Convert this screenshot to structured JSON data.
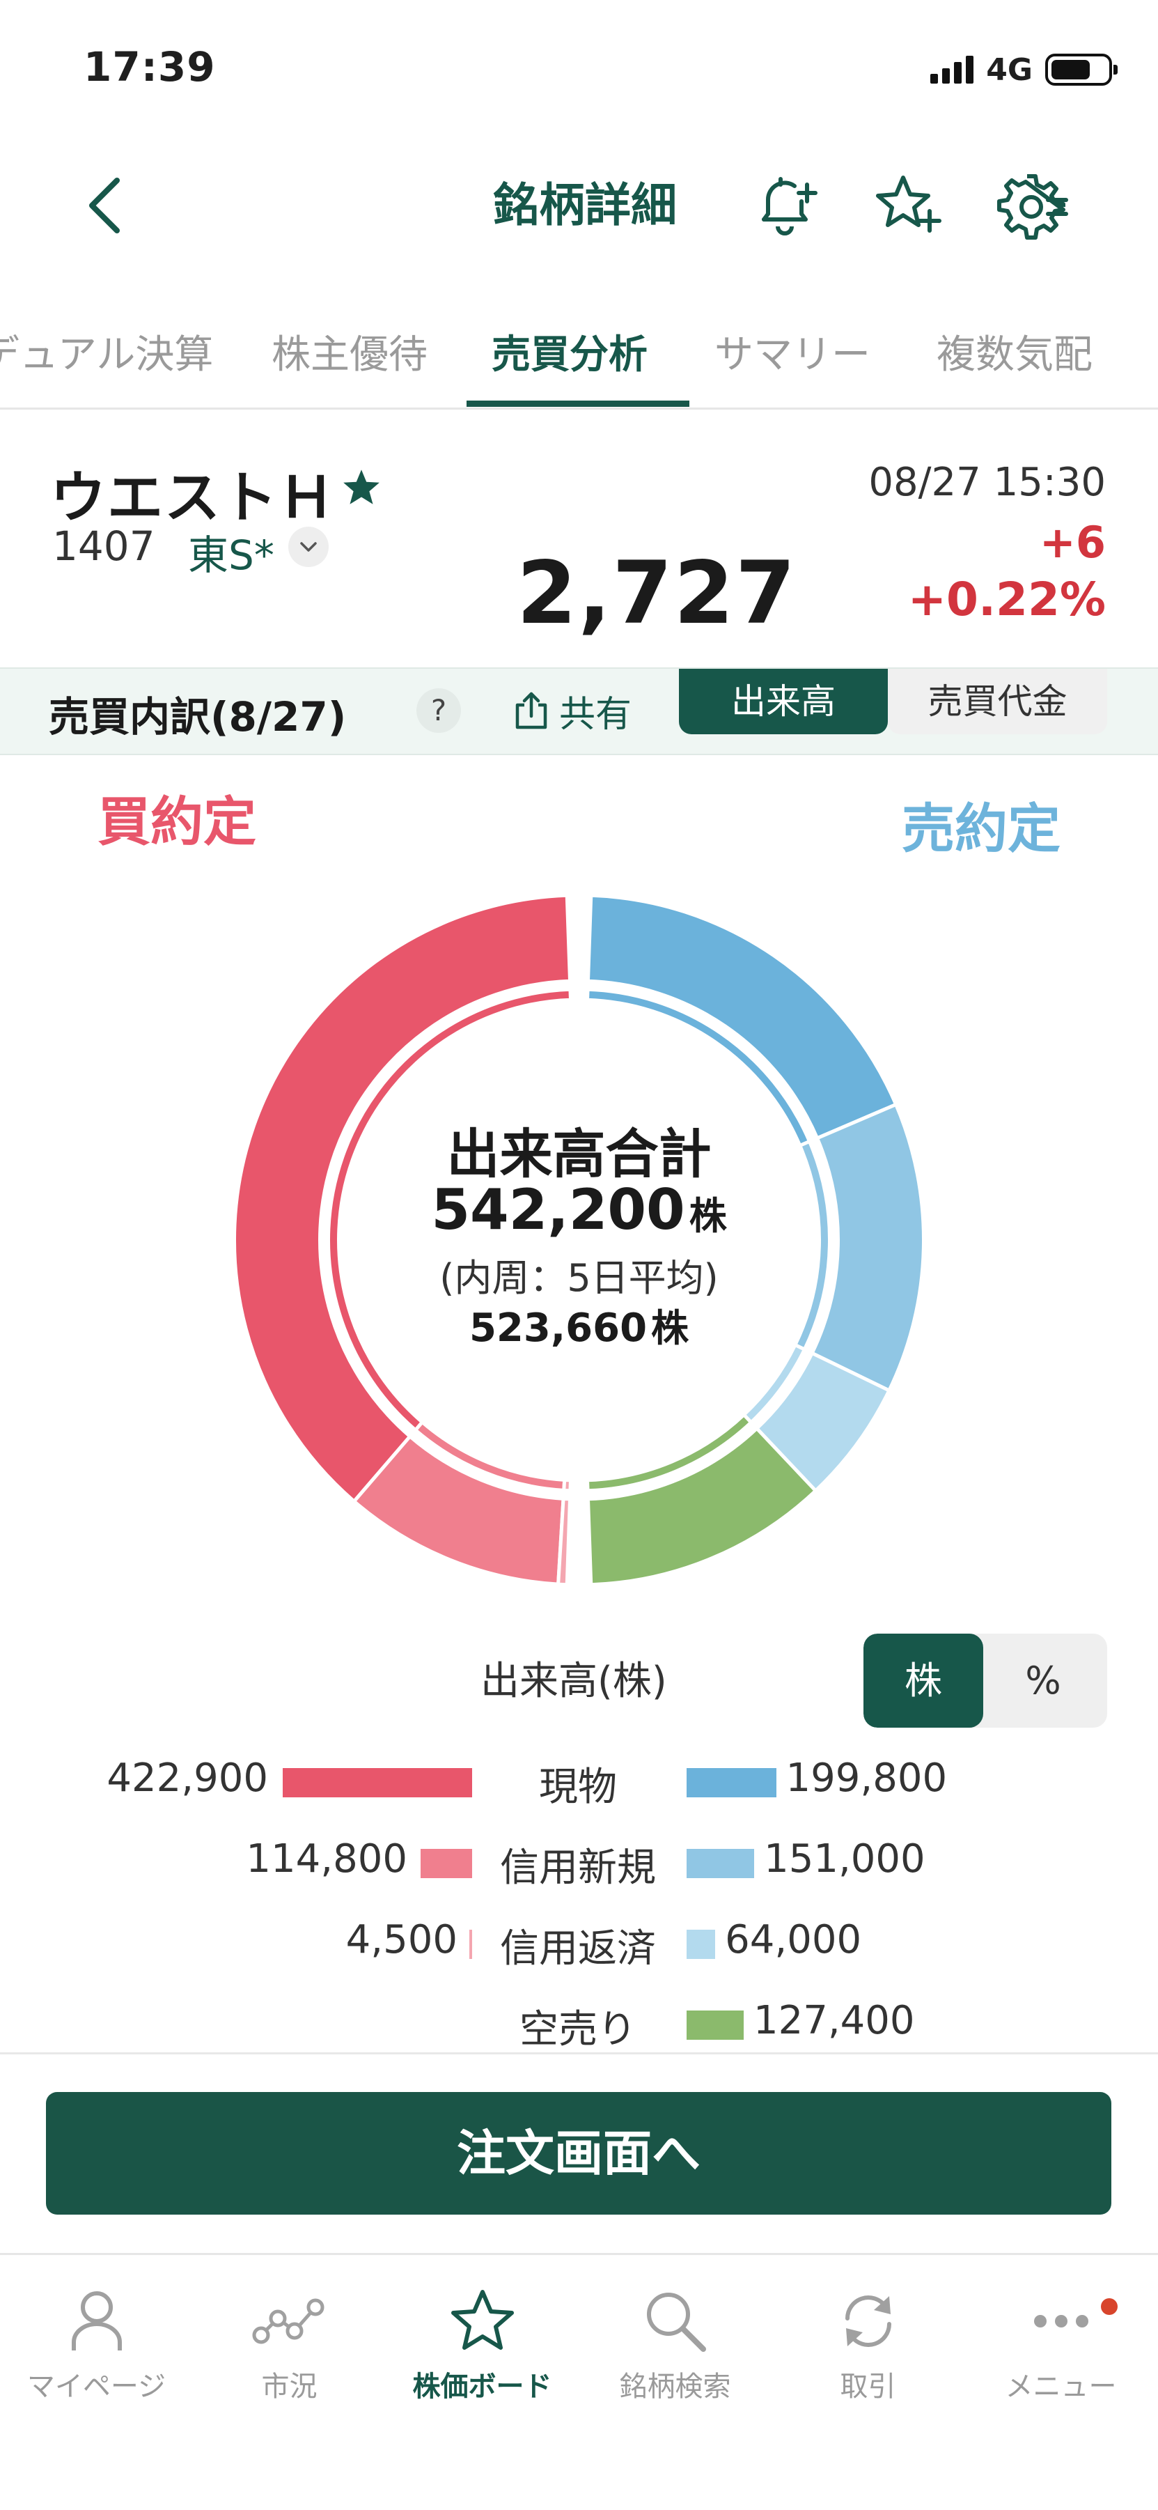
{
  "status_bar": {
    "time": "17:39",
    "network": "4G"
  },
  "header": {
    "title": "銘柄詳細"
  },
  "tabs": [
    {
      "label": "デュアル決算",
      "active": false
    },
    {
      "label": "株主優待",
      "active": false
    },
    {
      "label": "売買分析",
      "active": true
    },
    {
      "label": "サマリー",
      "active": false
    },
    {
      "label": "複数気配",
      "active": false
    }
  ],
  "stock": {
    "name": "ウエストＨ",
    "code": "1407",
    "market": "東S*",
    "price": "2,727",
    "datetime": "08/27 15:30",
    "change": "+6",
    "change_pct": "+0.22%"
  },
  "breakdown": {
    "title": "売買内訳(8/27)",
    "help": "?",
    "share_label": "共有",
    "mode_volume": "出来高",
    "mode_value": "売買代金"
  },
  "chart_labels": {
    "buy": "買約定",
    "sell": "売約定"
  },
  "center": {
    "title": "出来高合計",
    "total": "542,200",
    "unit": "株",
    "sub": "(内周：5日平均)",
    "avg": "523,660"
  },
  "legend": {
    "title": "出来高(株)",
    "unit_shares": "株",
    "unit_percent": "%"
  },
  "chart_data": {
    "type": "pie",
    "total": 542200,
    "outer_buy": [
      {
        "name": "現物",
        "value": 422900,
        "color": "#e8566b"
      },
      {
        "name": "信用新規",
        "value": 114800,
        "color": "#f07f8e"
      },
      {
        "name": "信用返済",
        "value": 4500,
        "color": "#f4a6b0"
      }
    ],
    "outer_sell": [
      {
        "name": "現物",
        "value": 199800,
        "color": "#6bb2db"
      },
      {
        "name": "信用新規",
        "value": 151000,
        "color": "#90c6e4"
      },
      {
        "name": "信用返済",
        "value": 64000,
        "color": "#b3daee"
      },
      {
        "name": "空売り",
        "value": 127400,
        "color": "#8bba6c"
      }
    ],
    "rows": [
      {
        "category": "現物",
        "buy": "422,900",
        "sell": "199,800"
      },
      {
        "category": "信用新規",
        "buy": "114,800",
        "sell": "151,000"
      },
      {
        "category": "信用返済",
        "buy": "4,500",
        "sell": "64,000"
      },
      {
        "category": "空売り",
        "buy": "",
        "sell": "127,400"
      }
    ]
  },
  "order_button": "注文画面へ",
  "nav": [
    {
      "label": "マイページ",
      "active": false
    },
    {
      "label": "市況",
      "active": false
    },
    {
      "label": "株価ボード",
      "active": true
    },
    {
      "label": "銘柄検索",
      "active": false
    },
    {
      "label": "取引",
      "active": false
    },
    {
      "label": "メニュー",
      "active": false
    }
  ]
}
